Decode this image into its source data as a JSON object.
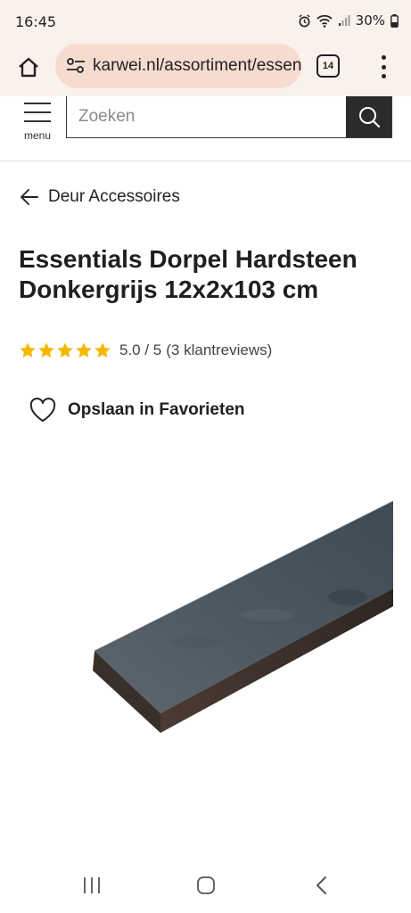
{
  "status_bar": {
    "time": "16:45",
    "battery": "30%"
  },
  "browser": {
    "url": "karwei.nl/assortiment/essentials-dorpel",
    "tab_count": "14"
  },
  "site_header": {
    "menu_label": "menu",
    "search_placeholder": "Zoeken"
  },
  "breadcrumb": {
    "label": "Deur Accessoires"
  },
  "product": {
    "title": "Essentials Dorpel Hardsteen Donkergrijs 12x2x103 cm",
    "rating": {
      "stars": 5,
      "max_stars": 5,
      "score": "5.0 / 5",
      "count": "(3 klantreviews)",
      "star_color": "#f5b800"
    },
    "favorite_label": "Opslaan in Favorieten"
  },
  "colors": {
    "browser_bg": "#fbf1ec",
    "url_pill_bg": "#f6dccf",
    "search_button_bg": "#2b2b2b"
  }
}
